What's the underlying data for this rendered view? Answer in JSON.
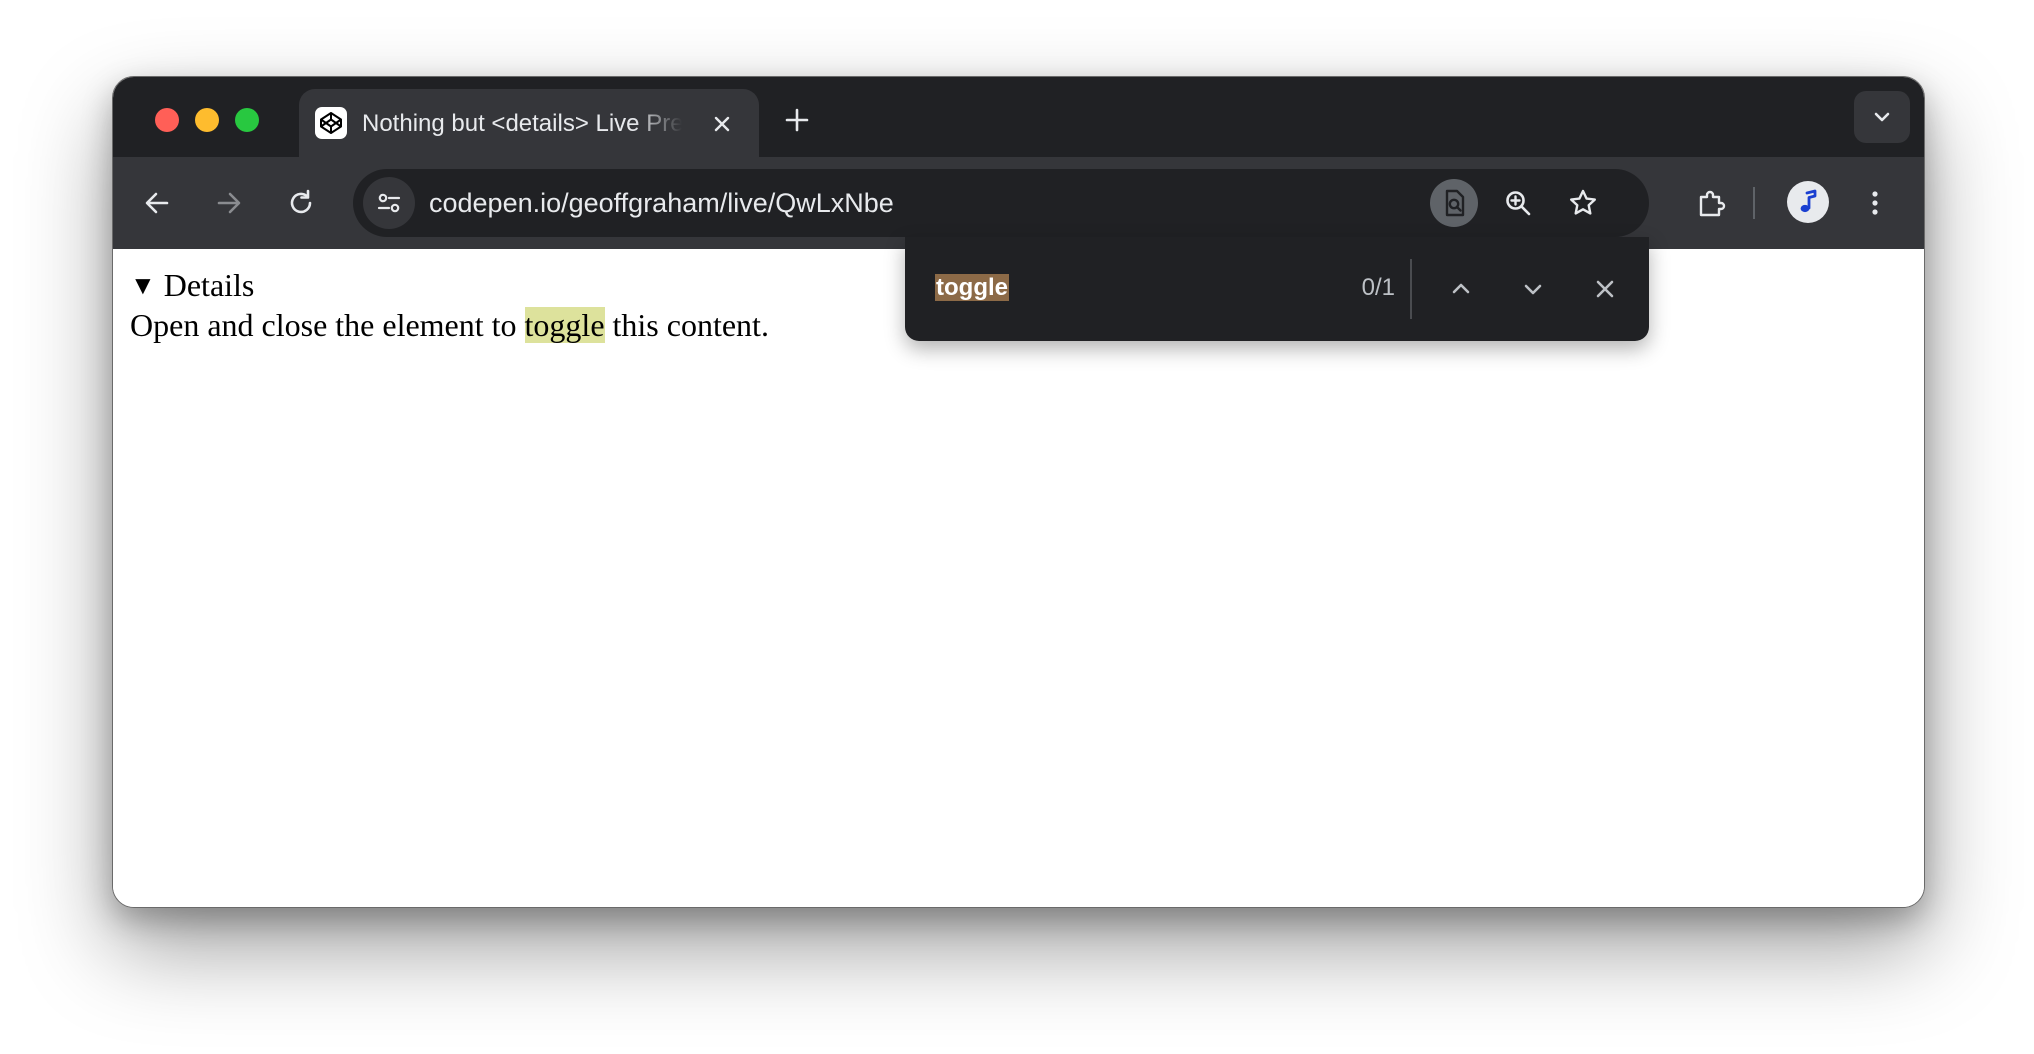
{
  "browser": {
    "tab": {
      "title": "Nothing but <details> Live Preview",
      "favicon": "codepen-icon"
    },
    "address_bar": {
      "url": "codepen.io/geoffgraham/live/QwLxNbe"
    },
    "colors": {
      "titlebar": "#202124",
      "toolbar": "#35363a",
      "traffic_close": "#ff5f57",
      "traffic_minimize": "#febc2e",
      "traffic_maximize": "#28c840"
    }
  },
  "find_bar": {
    "query": "toggle",
    "count": "0/1"
  },
  "page": {
    "summary_marker": "▼",
    "summary": "Details",
    "content_before": "Open and close the element to ",
    "content_match": "toggle",
    "content_after": " this content.",
    "highlight_color": "#dde29c"
  }
}
